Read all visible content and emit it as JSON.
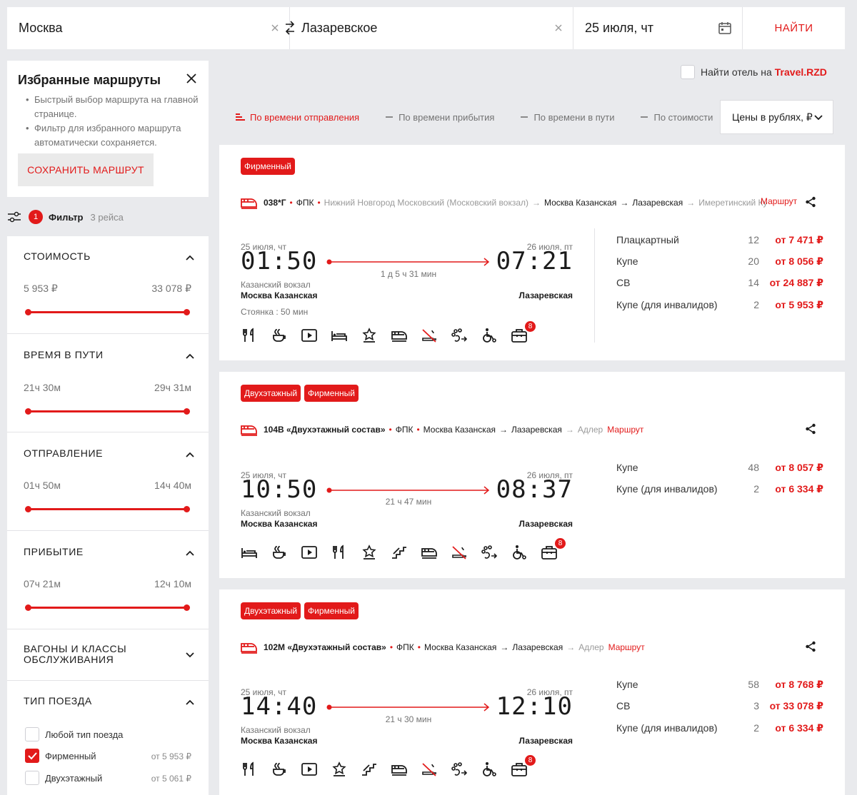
{
  "search": {
    "from": "Москва",
    "to": "Лазаревское",
    "date": "25 июля, чт",
    "find_label": "НАЙТИ"
  },
  "favorites": {
    "title": "Избранные маршруты",
    "bullets": [
      "Быстрый выбор маршрута на главной странице.",
      "Фильтр для избранного маршрута автоматически сохраняется."
    ],
    "save_label": "СОХРАНИТЬ МАРШРУТ"
  },
  "filter": {
    "badge": "1",
    "label": "Фильтр",
    "count": "3 рейса",
    "cost": {
      "title": "Стоимость",
      "min": "5 953 ₽",
      "max": "33 078 ₽"
    },
    "travel_time": {
      "title": "Время в пути",
      "min": "21ч 30м",
      "max": "29ч 31м"
    },
    "departure": {
      "title": "Отправление",
      "min": "01ч 50м",
      "max": "14ч 40м"
    },
    "arrival": {
      "title": "Прибытие",
      "min": "07ч 21м",
      "max": "12ч 10м"
    },
    "wagons": {
      "title": "Вагоны и классы обслуживания"
    },
    "train_type": {
      "title": "Тип поезда",
      "options": [
        {
          "label": "Любой тип поезда",
          "price": "",
          "checked": false
        },
        {
          "label": "Фирменный",
          "price": "от 5 953 ₽",
          "checked": true
        },
        {
          "label": "Двухэтажный",
          "price": "от 5 061 ₽",
          "checked": false
        }
      ]
    }
  },
  "hotel": {
    "prefix": "Найти отель на",
    "brand": "Travel.RZD"
  },
  "sort": {
    "options": [
      "По времени отправления",
      "По времени прибытия",
      "По времени в пути",
      "По стоимости"
    ],
    "active": 0,
    "currency": "Цены в рублях, ₽"
  },
  "accent_color": "#e21a1a",
  "trains": [
    {
      "tags": [
        "Фирменный"
      ],
      "number": "038*Г",
      "carrier": "ФПК",
      "origin": "Нижний Новгород Московский (Московский вокзал)",
      "from": "Москва Казанская",
      "to": "Лазаревская",
      "destination": "Имеретинский Курорт",
      "route_label": "Маршрут",
      "dep_date": "25 июля, чт",
      "dep_time": "01:50",
      "arr_date": "26 июля, пт",
      "arr_time": "07:21",
      "duration": "1 д 5 ч 31 мин",
      "dep_station": "Казанский вокзал",
      "dep_city": "Москва Казанская",
      "arr_city": "Лазаревская",
      "stop": "Стоянка : 50 мин",
      "icons": [
        "dining-icon",
        "coffee-icon",
        "video-icon",
        "bed-icon",
        "star-service-icon",
        "train-icon",
        "no-smoking-icon",
        "pet-icon",
        "wheelchair-icon",
        "luggage-icon"
      ],
      "badge_count": "8",
      "classes": [
        {
          "name": "Плацкартный",
          "seats": "12",
          "price": "от 7 471 ₽"
        },
        {
          "name": "Купе",
          "seats": "20",
          "price": "от 8 056 ₽"
        },
        {
          "name": "СВ",
          "seats": "14",
          "price": "от 24 887 ₽"
        },
        {
          "name": "Купе (для инвалидов)",
          "seats": "2",
          "price": "от 5 953 ₽"
        }
      ]
    },
    {
      "tags": [
        "Двухэтажный",
        "Фирменный"
      ],
      "number": "104В «Двухэтажный состав»",
      "carrier": "ФПК",
      "from": "Москва Казанская",
      "to": "Лазаревская",
      "destination": "Адлер",
      "route_label": "Маршрут",
      "dep_date": "25 июля, чт",
      "dep_time": "10:50",
      "arr_date": "26 июля, пт",
      "arr_time": "08:37",
      "duration": "21 ч 47 мин",
      "dep_station": "Казанский вокзал",
      "dep_city": "Москва Казанская",
      "arr_city": "Лазаревская",
      "icons": [
        "bed-icon",
        "coffee-icon",
        "video-icon",
        "dining-icon",
        "star-service-icon",
        "stairs-icon",
        "train-icon",
        "no-smoking-icon",
        "pet-icon",
        "wheelchair-icon",
        "luggage-icon"
      ],
      "badge_count": "8",
      "classes": [
        {
          "name": "Купе",
          "seats": "48",
          "price": "от 8 057 ₽"
        },
        {
          "name": "Купе (для инвалидов)",
          "seats": "2",
          "price": "от 6 334 ₽"
        }
      ]
    },
    {
      "tags": [
        "Двухэтажный",
        "Фирменный"
      ],
      "number": "102М «Двухэтажный состав»",
      "carrier": "ФПК",
      "from": "Москва Казанская",
      "to": "Лазаревская",
      "destination": "Адлер",
      "route_label": "Маршрут",
      "dep_date": "25 июля, чт",
      "dep_time": "14:40",
      "arr_date": "26 июля, пт",
      "arr_time": "12:10",
      "duration": "21 ч 30 мин",
      "dep_station": "Казанский вокзал",
      "dep_city": "Москва Казанская",
      "arr_city": "Лазаревская",
      "icons": [
        "dining-icon",
        "coffee-icon",
        "video-icon",
        "star-service-icon",
        "stairs-icon",
        "train-icon",
        "no-smoking-icon",
        "pet-icon",
        "wheelchair-icon",
        "luggage-icon"
      ],
      "badge_count": "8",
      "classes": [
        {
          "name": "Купе",
          "seats": "58",
          "price": "от 8 768 ₽"
        },
        {
          "name": "СВ",
          "seats": "3",
          "price": "от 33 078 ₽"
        },
        {
          "name": "Купе (для инвалидов)",
          "seats": "2",
          "price": "от 6 334 ₽"
        }
      ]
    }
  ]
}
